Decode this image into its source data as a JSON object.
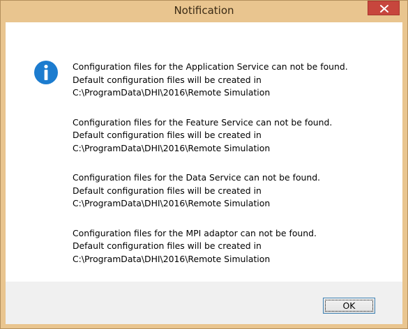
{
  "window": {
    "title": "Notification"
  },
  "icons": {
    "close": "close-icon",
    "info": "info-icon"
  },
  "colors": {
    "titlebar": "#e9c58f",
    "close_button": "#c7463d",
    "info_icon": "#1c7ccf",
    "footer": "#f0f0f0"
  },
  "messages": [
    {
      "lines": [
        "Configuration files for the Application Service can not be found.",
        "Default configuration files will be created in",
        "C:\\ProgramData\\DHI\\2016\\Remote Simulation"
      ]
    },
    {
      "lines": [
        "Configuration files for the Feature Service can not be found.",
        "Default configuration files will be created in",
        "C:\\ProgramData\\DHI\\2016\\Remote Simulation"
      ]
    },
    {
      "lines": [
        "Configuration files for the Data Service can not be found.",
        "Default configuration files will be created in",
        "C:\\ProgramData\\DHI\\2016\\Remote Simulation"
      ]
    },
    {
      "lines": [
        "Configuration files for the MPI adaptor can not be found.",
        "Default configuration files will be created in",
        "C:\\ProgramData\\DHI\\2016\\Remote Simulation"
      ]
    }
  ],
  "footer": {
    "ok_label": "OK"
  }
}
